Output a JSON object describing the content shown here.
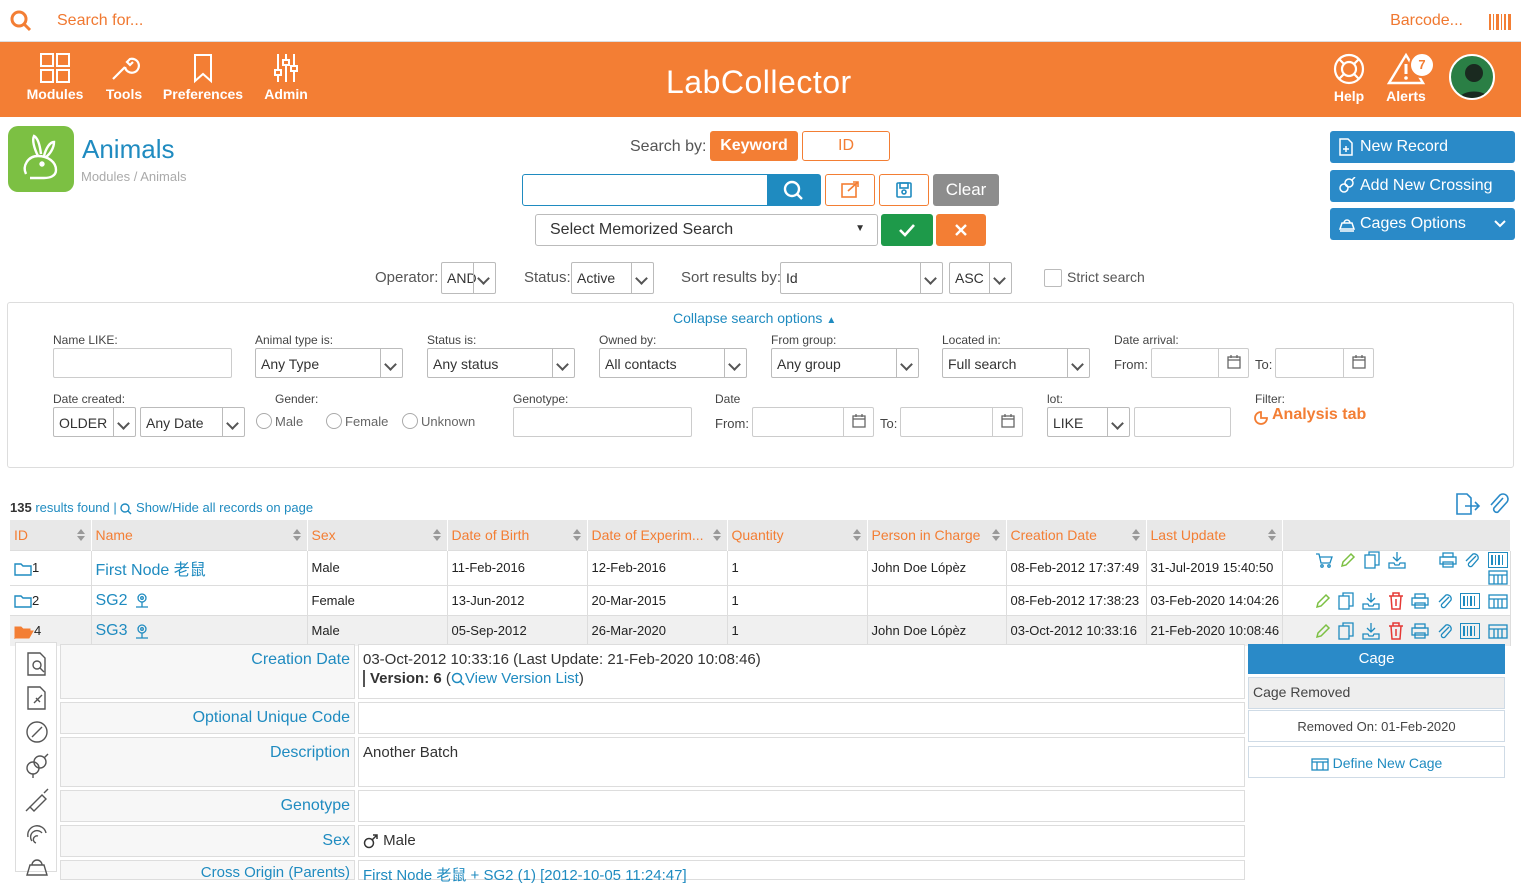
{
  "topbar": {
    "search_placeholder": "Search for...",
    "barcode_label": "Barcode..."
  },
  "nav": {
    "modules": "Modules",
    "tools": "Tools",
    "preferences": "Preferences",
    "admin": "Admin",
    "help": "Help",
    "alerts": "Alerts",
    "alert_count": "7",
    "logo": "LabCollector"
  },
  "page": {
    "title": "Animals",
    "breadcrumb": "Modules / Animals"
  },
  "search": {
    "search_by_label": "Search by:",
    "keyword_label": "Keyword",
    "id_label": "ID",
    "clear_label": "Clear",
    "memorized_placeholder": "Select Memorized Search",
    "operator_label": "Operator:",
    "operator_value": "AND",
    "status_label": "Status:",
    "status_value": "Active",
    "sort_label": "Sort results by:",
    "sort_value": "Id",
    "order_value": "ASC",
    "strict_label": "Strict search"
  },
  "actions": {
    "new_record": "New Record",
    "add_crossing": "Add New Crossing",
    "cages_options": "Cages Options"
  },
  "filters": {
    "collapse_label": "Collapse search options",
    "name_like": "Name LIKE:",
    "animal_type_label": "Animal type is:",
    "animal_type_value": "Any Type",
    "status_label": "Status is:",
    "status_value": "Any status",
    "owned_label": "Owned by:",
    "owned_value": "All contacts",
    "group_label": "From group:",
    "group_value": "Any group",
    "located_label": "Located in:",
    "located_value": "Full search",
    "arrival_label": "Date arrival:",
    "from_label": "From:",
    "to_label": "To:",
    "created_label": "Date created:",
    "created_mode": "OLDER",
    "created_value": "Any Date",
    "gender_label": "Gender:",
    "gender_male": "Male",
    "gender_female": "Female",
    "gender_unknown": "Unknown",
    "genotype_label": "Genotype:",
    "date_label": "Date",
    "lot_label": "lot:",
    "lot_value": "LIKE",
    "filter_label": "Filter:",
    "analysis_tab": "Analysis tab"
  },
  "results": {
    "count": "135",
    "found_text": "results found",
    "separator": "|",
    "show_hide": "Show/Hide all records on page"
  },
  "table": {
    "headers": [
      "ID",
      "Name",
      "Sex",
      "Date of Birth",
      "Date of Experim...",
      "Quantity",
      "Person in Charge",
      "Creation Date",
      "Last Update"
    ],
    "rows": [
      {
        "id": "1",
        "name": "First Node 老鼠",
        "sex": "Male",
        "dob": "11-Feb-2016",
        "exp": "12-Feb-2016",
        "qty": "1",
        "person": "John Doe Lópèz",
        "created": "08-Feb-2012 17:37:49",
        "updated": "31-Jul-2019 15:40:50"
      },
      {
        "id": "2",
        "name": "SG2",
        "sex": "Female",
        "dob": "13-Jun-2012",
        "exp": "20-Mar-2015",
        "qty": "1",
        "person": "",
        "created": "08-Feb-2012 17:38:23",
        "updated": "03-Feb-2020 14:04:26"
      },
      {
        "id": "4",
        "name": "SG3",
        "sex": "Male",
        "dob": "05-Sep-2012",
        "exp": "26-Mar-2020",
        "qty": "1",
        "person": "John Doe Lópèz",
        "created": "03-Oct-2012 10:33:16",
        "updated": "21-Feb-2020 10:08:46"
      }
    ]
  },
  "detail": {
    "creation_label": "Creation Date",
    "creation_value": "03-Oct-2012 10:33:16 (Last Update: 21-Feb-2020 10:08:46)",
    "version_label": "Version:",
    "version_number": "6",
    "version_open": "(",
    "version_link": "View Version List",
    "version_close": ")",
    "unique_code_label": "Optional Unique Code",
    "unique_code_value": "",
    "description_label": "Description",
    "description_value": "Another Batch",
    "genotype_label": "Genotype",
    "genotype_value": "",
    "sex_label": "Sex",
    "sex_value": "Male",
    "origin_label": "Cross Origin (Parents)",
    "origin_value": "First Node 老鼠 + SG2 (1) [2012-10-05 11:24:47]"
  },
  "cage": {
    "header": "Cage",
    "status": "Cage Removed",
    "removed_on": "Removed On: 01-Feb-2020",
    "define_new": "Define New Cage"
  },
  "colors": {
    "brand_orange": "#f37e34",
    "link_blue": "#1f8bc0",
    "action_blue": "#2a8ac8",
    "ok_green": "#1e9a4a",
    "tile_green": "#7cc043"
  }
}
